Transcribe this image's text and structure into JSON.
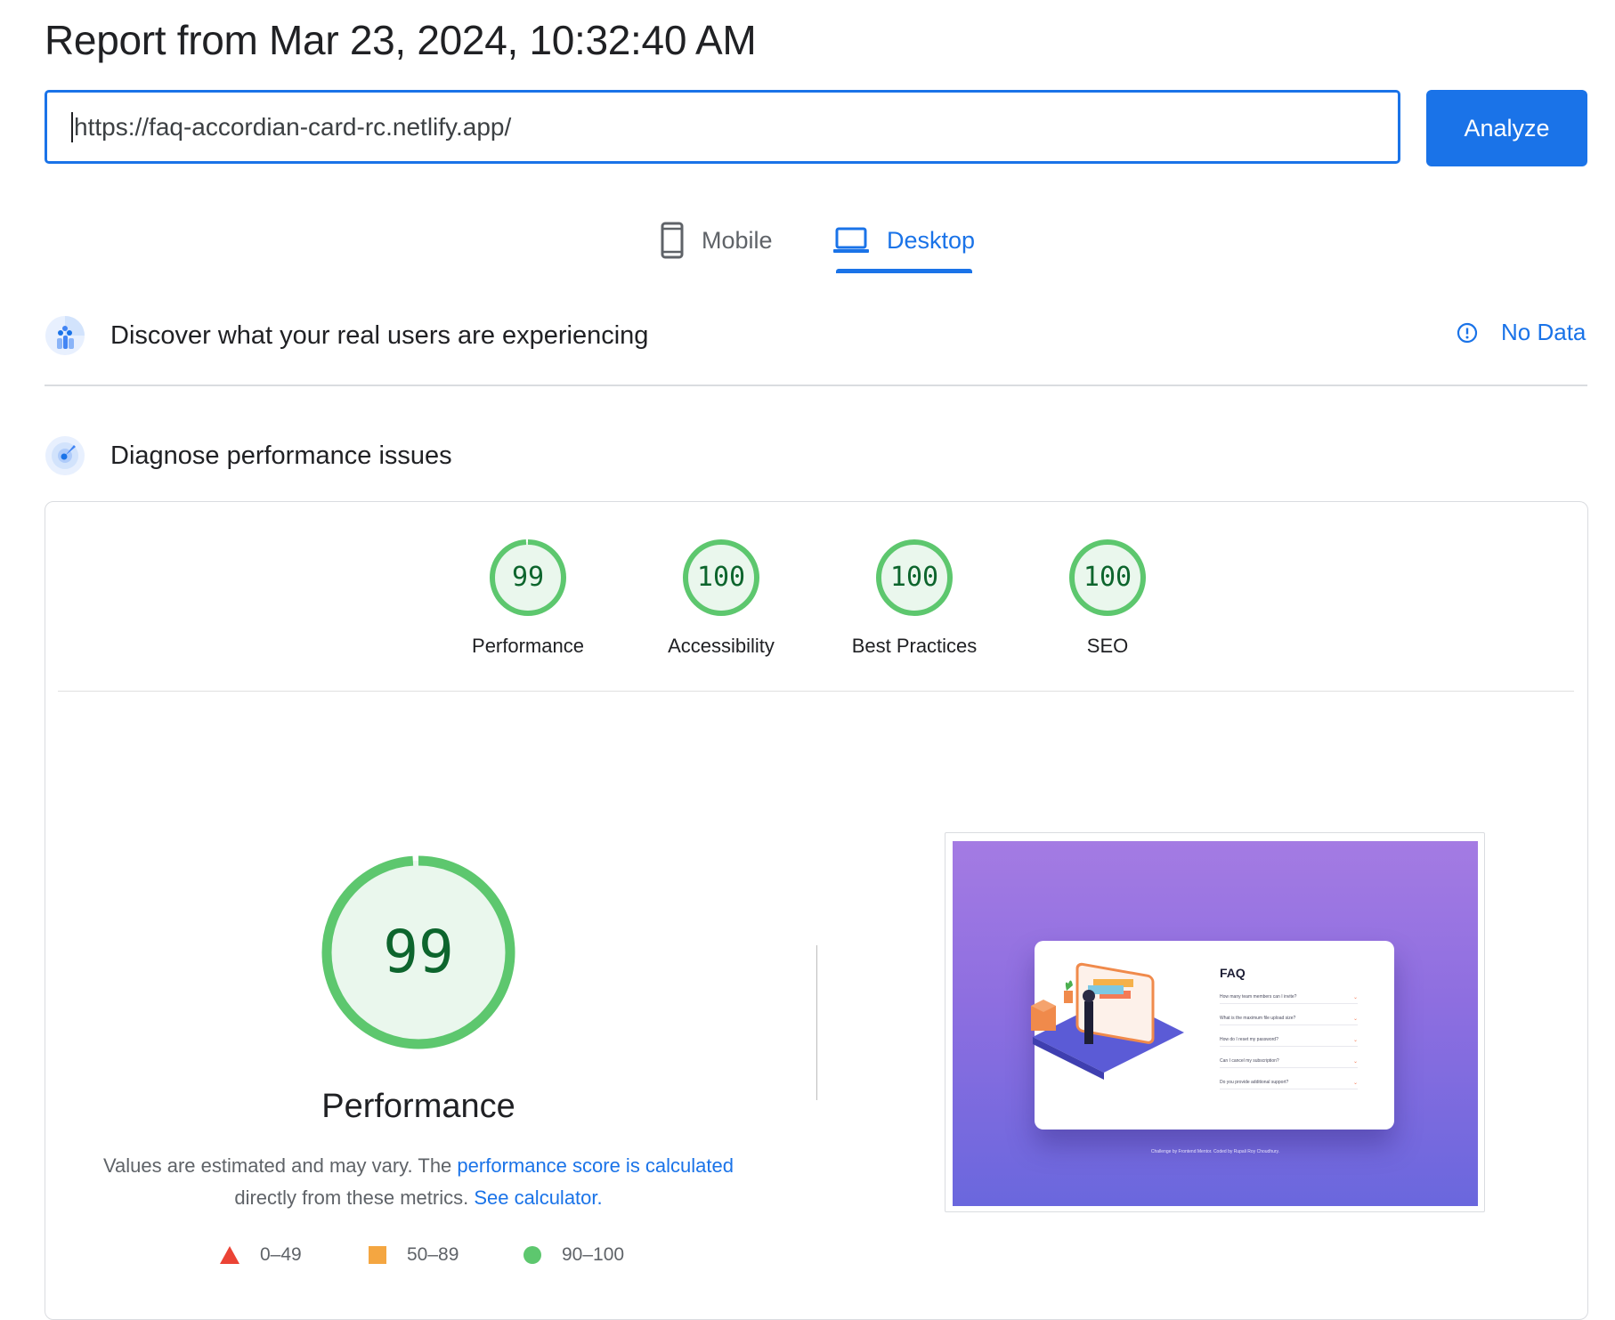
{
  "report": {
    "title": "Report from Mar 23, 2024, 10:32:40 AM"
  },
  "search": {
    "url": "https://faq-accordian-card-rc.netlify.app/",
    "analyze_label": "Analyze"
  },
  "tabs": [
    {
      "label": "Mobile",
      "icon": "smartphone-icon",
      "active": false
    },
    {
      "label": "Desktop",
      "icon": "laptop-icon",
      "active": true
    }
  ],
  "crux": {
    "title": "Discover what your real users are experiencing",
    "status": "No Data",
    "icon": "crux-users-icon",
    "status_icon": "info-icon"
  },
  "diagnose": {
    "title": "Diagnose performance issues",
    "icon": "lighthouse-icon"
  },
  "scores": [
    {
      "label": "Performance",
      "value": "99",
      "fraction": 0.99
    },
    {
      "label": "Accessibility",
      "value": "100",
      "fraction": 1.0
    },
    {
      "label": "Best Practices",
      "value": "100",
      "fraction": 1.0
    },
    {
      "label": "SEO",
      "value": "100",
      "fraction": 1.0
    }
  ],
  "performance": {
    "score": "99",
    "fraction": 0.99,
    "title": "Performance",
    "desc_prefix": "Values are estimated and may vary. The ",
    "desc_link": "performance score is calculated",
    "desc_middle": " directly from these metrics. ",
    "desc_link2": "See calculator."
  },
  "legend": [
    {
      "range": "0–49",
      "shape": "triangle",
      "color": "#eb4335"
    },
    {
      "range": "50–89",
      "shape": "square",
      "color": "#f4a641"
    },
    {
      "range": "90–100",
      "shape": "circle",
      "color": "#5dc76e"
    }
  ],
  "screenshot": {
    "title": "FAQ",
    "questions": [
      "How many team members can I invite?",
      "What is the maximum file upload size?",
      "How do I reset my password?",
      "Can I cancel my subscription?",
      "Do you provide additional support?"
    ],
    "footer": "Challenge by Frontend Mentor. Coded by Rupali Roy Choudhury."
  },
  "colors": {
    "accent": "#1a73e8",
    "pass": "#0cce6b",
    "pass_text": "#0d652d",
    "pass_bg": "#eaf7ed"
  }
}
